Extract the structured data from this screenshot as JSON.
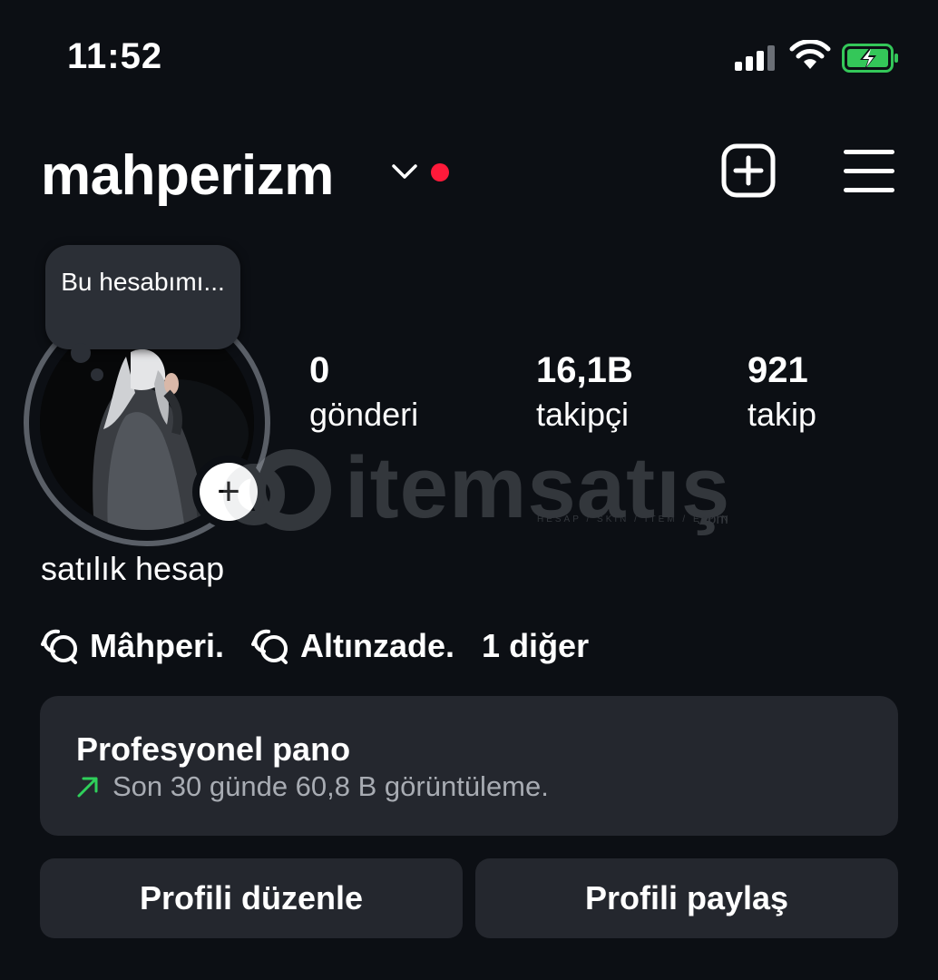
{
  "status_bar": {
    "time": "11:52",
    "icons": [
      "cellular-signal-icon",
      "wifi-icon",
      "battery-charging-icon"
    ]
  },
  "header": {
    "username": "mahperizm",
    "icons": [
      "chevron-down-icon",
      "notification-dot",
      "new-post-icon",
      "menu-icon"
    ]
  },
  "note": {
    "text": "Bu hesabımı..."
  },
  "stats": [
    {
      "value": "0",
      "label": "gönderi"
    },
    {
      "value": "16,1B",
      "label": "takipçi"
    },
    {
      "value": "921",
      "label": "takip"
    }
  ],
  "watermark": {
    "brand": "itemsatış",
    "tagline": "HESAP / SKIN / ITEM / E-PIN",
    "suffix": ".com"
  },
  "bio": "satılık hesap",
  "threads_links": [
    {
      "label": "Mâhperi."
    },
    {
      "label": "Altınzade."
    }
  ],
  "more_links": "1 diğer",
  "pro_dashboard": {
    "title": "Profesyonel pano",
    "subtitle": "Son 30 günde 60,8 B görüntüleme."
  },
  "buttons": {
    "edit": "Profili düzenle",
    "share": "Profili paylaş"
  },
  "colors": {
    "background": "#0c0f14",
    "card": "#24272e",
    "accent_red": "#ff1a3a",
    "trend_green": "#2fd05b",
    "battery_green": "#34c759"
  }
}
